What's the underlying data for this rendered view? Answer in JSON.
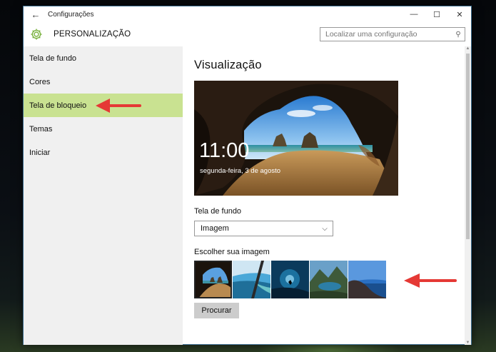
{
  "window": {
    "title": "Configurações",
    "back": "←",
    "minimize": "—",
    "maximize": "☐",
    "close": "✕"
  },
  "header": {
    "title": "PERSONALIZAÇÃO",
    "icon": "gear-icon",
    "accent_color": "#7cb342"
  },
  "search": {
    "placeholder": "Localizar uma configuração",
    "icon": "search-icon"
  },
  "sidebar": {
    "items": [
      {
        "label": "Tela de fundo",
        "active": false
      },
      {
        "label": "Cores",
        "active": false
      },
      {
        "label": "Tela de bloqueio",
        "active": true
      },
      {
        "label": "Temas",
        "active": false
      },
      {
        "label": "Iniciar",
        "active": false
      }
    ],
    "active_color": "#c9e291"
  },
  "main": {
    "heading": "Visualização",
    "preview": {
      "time": "11:00",
      "date": "segunda-feira, 3 de agosto"
    },
    "background_label": "Tela de fundo",
    "background_select": "Imagem",
    "choose_label": "Escolher sua imagem",
    "thumbnails": [
      "cave-beach",
      "ocean-window",
      "underwater-diver",
      "mountain-lake",
      "rock-ocean"
    ],
    "browse_button": "Procurar"
  },
  "annotations": {
    "arrow_color": "#e53935"
  }
}
